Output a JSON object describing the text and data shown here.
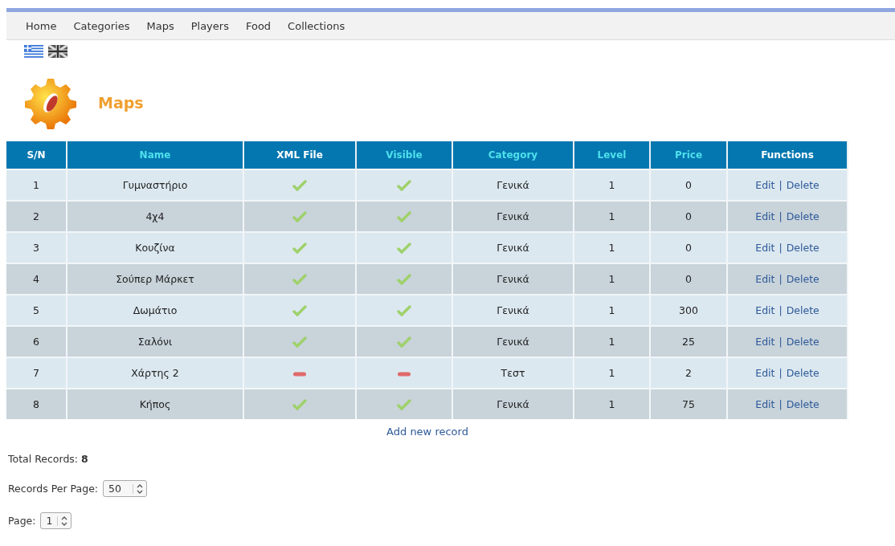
{
  "nav": {
    "items": [
      "Home",
      "Categories",
      "Maps",
      "Players",
      "Food",
      "Collections"
    ]
  },
  "languages": [
    {
      "kind": "greek"
    },
    {
      "kind": "uk"
    }
  ],
  "page_title": "Maps",
  "table": {
    "columns": [
      {
        "label": "S/N",
        "sortable": false
      },
      {
        "label": "Name",
        "sortable": true
      },
      {
        "label": "XML File",
        "sortable": false
      },
      {
        "label": "Visible",
        "sortable": true
      },
      {
        "label": "Category",
        "sortable": true
      },
      {
        "label": "Level",
        "sortable": true
      },
      {
        "label": "Price",
        "sortable": true
      },
      {
        "label": "Functions",
        "sortable": false
      }
    ],
    "rows": [
      {
        "sn": "1",
        "name": "Γυμναστήριο",
        "xml_file": true,
        "visible": true,
        "category": "Γενικά",
        "level": "1",
        "price": "0",
        "functions": [
          "Edit",
          "|",
          "Delete"
        ]
      },
      {
        "sn": "2",
        "name": "4χ4",
        "xml_file": true,
        "visible": true,
        "category": "Γενικά",
        "level": "1",
        "price": "0",
        "functions": [
          "Edit",
          "|",
          "Delete"
        ]
      },
      {
        "sn": "3",
        "name": "Κουζίνα",
        "xml_file": true,
        "visible": true,
        "category": "Γενικά",
        "level": "1",
        "price": "0",
        "functions": [
          "Edit",
          "|",
          "Delete"
        ]
      },
      {
        "sn": "4",
        "name": "Σούπερ Μάρκετ",
        "xml_file": true,
        "visible": true,
        "category": "Γενικά",
        "level": "1",
        "price": "0",
        "functions": [
          "Edit",
          "|",
          "Delete"
        ]
      },
      {
        "sn": "5",
        "name": "Δωμάτιο",
        "xml_file": true,
        "visible": true,
        "category": "Γενικά",
        "level": "1",
        "price": "300",
        "functions": [
          "Edit",
          "|",
          "Delete"
        ]
      },
      {
        "sn": "6",
        "name": "Σαλόνι",
        "xml_file": true,
        "visible": true,
        "category": "Γενικά",
        "level": "1",
        "price": "25",
        "functions": [
          "Edit",
          "|",
          "Delete"
        ]
      },
      {
        "sn": "7",
        "name": "Χάρτης 2",
        "xml_file": false,
        "visible": false,
        "category": "Τεστ",
        "level": "1",
        "price": "2",
        "functions": [
          "Edit",
          "|",
          "Delete"
        ]
      },
      {
        "sn": "8",
        "name": "Κήπος",
        "xml_file": true,
        "visible": true,
        "category": "Γενικά",
        "level": "1",
        "price": "75",
        "functions": [
          "Edit",
          "|",
          "Delete"
        ]
      }
    ]
  },
  "add_link": "Add new record",
  "total_records": "Total Records: **8**",
  "records_per_page": {
    "label": "Records Per Page:",
    "value": "50"
  },
  "page": {
    "label": "Page:",
    "value": "1"
  }
}
